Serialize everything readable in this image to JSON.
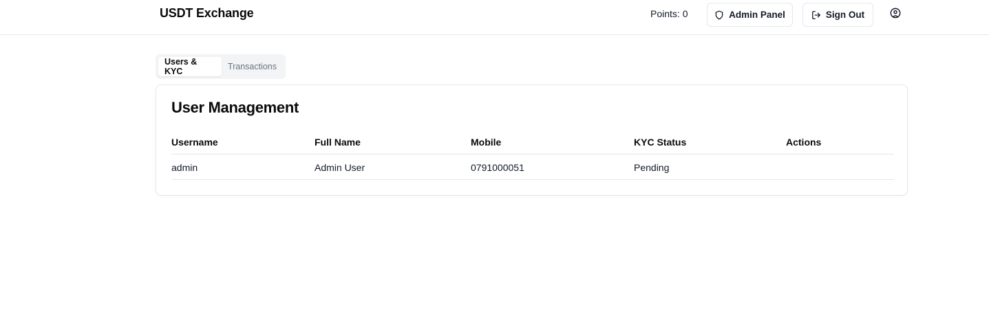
{
  "header": {
    "brand": "USDT Exchange",
    "points": "Points: 0",
    "admin_panel_label": "Admin Panel",
    "sign_out_label": "Sign Out"
  },
  "tabs": [
    {
      "label": "Users & KYC",
      "active": true
    },
    {
      "label": "Transactions",
      "active": false
    }
  ],
  "user_management": {
    "title": "User Management",
    "columns": [
      "Username",
      "Full Name",
      "Mobile",
      "KYC Status",
      "Actions"
    ],
    "rows": [
      {
        "username": "admin",
        "full_name": "Admin User",
        "mobile": "0791000051",
        "kyc_status": "Pending",
        "actions": ""
      }
    ]
  },
  "icons": {
    "admin_panel": "shield-icon",
    "sign_out": "log-out-icon",
    "account": "user-circle-icon"
  },
  "colors": {
    "border": "#e5e7eb",
    "tab_bg": "#f3f4f6",
    "muted_text": "#6b7280"
  }
}
